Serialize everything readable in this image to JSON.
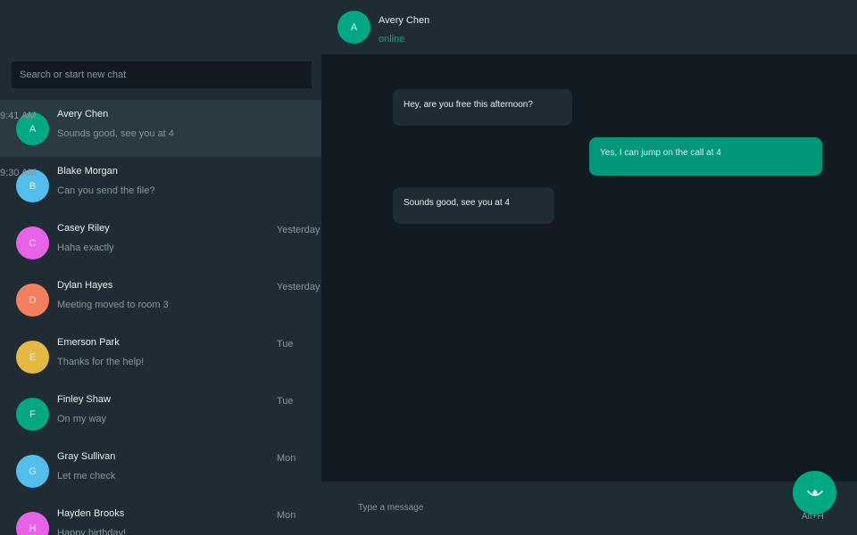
{
  "colors": {
    "accent": "#00a884",
    "sidebar_bg": "#202c33",
    "chat_bg": "#111b21",
    "bubble_in": "#202c33",
    "bubble_out": "#00977a",
    "muted_text": "#8696a0"
  },
  "search": {
    "placeholder": "Search or start new chat"
  },
  "chats": [
    {
      "initial": "A",
      "name": "Avery Chen",
      "preview": "Sounds good, see you at 4",
      "time": "9:41 AM",
      "color": "#00a884",
      "active": true
    },
    {
      "initial": "B",
      "name": "Blake Morgan",
      "preview": "Can you send the file?",
      "time": "9:30 AM",
      "color": "#53bdeb",
      "active": false
    },
    {
      "initial": "C",
      "name": "Casey Riley",
      "preview": "Haha exactly",
      "time": "Yesterday",
      "color": "#e862e8",
      "active": false
    },
    {
      "initial": "D",
      "name": "Dylan Hayes",
      "preview": "Meeting moved to room 3",
      "time": "Yesterday",
      "color": "#f2805f",
      "active": false
    },
    {
      "initial": "E",
      "name": "Emerson Park",
      "preview": "Thanks for the help!",
      "time": "Tue",
      "color": "#e4b941",
      "active": false
    },
    {
      "initial": "F",
      "name": "Finley Shaw",
      "preview": "On my way",
      "time": "Tue",
      "color": "#00a884",
      "active": false
    },
    {
      "initial": "G",
      "name": "Gray Sullivan",
      "preview": "Let me check",
      "time": "Mon",
      "color": "#53bdeb",
      "active": false
    },
    {
      "initial": "H",
      "name": "Hayden Brooks",
      "preview": "Happy birthday!",
      "time": "Mon",
      "color": "#e862e8",
      "active": false
    }
  ],
  "conversation": {
    "initial": "A",
    "name": "Avery Chen",
    "status": "online",
    "messages": [
      {
        "text": "Hey, are you free this afternoon?",
        "direction": "in"
      },
      {
        "text": "Yes, I can jump on the call at 4",
        "direction": "out"
      },
      {
        "text": "Sounds good, see you at 4",
        "direction": "in"
      }
    ]
  },
  "composer": {
    "placeholder": "Type a message",
    "shortcut": "Alt+H"
  },
  "fab": {
    "icon": "accessibility-icon"
  }
}
